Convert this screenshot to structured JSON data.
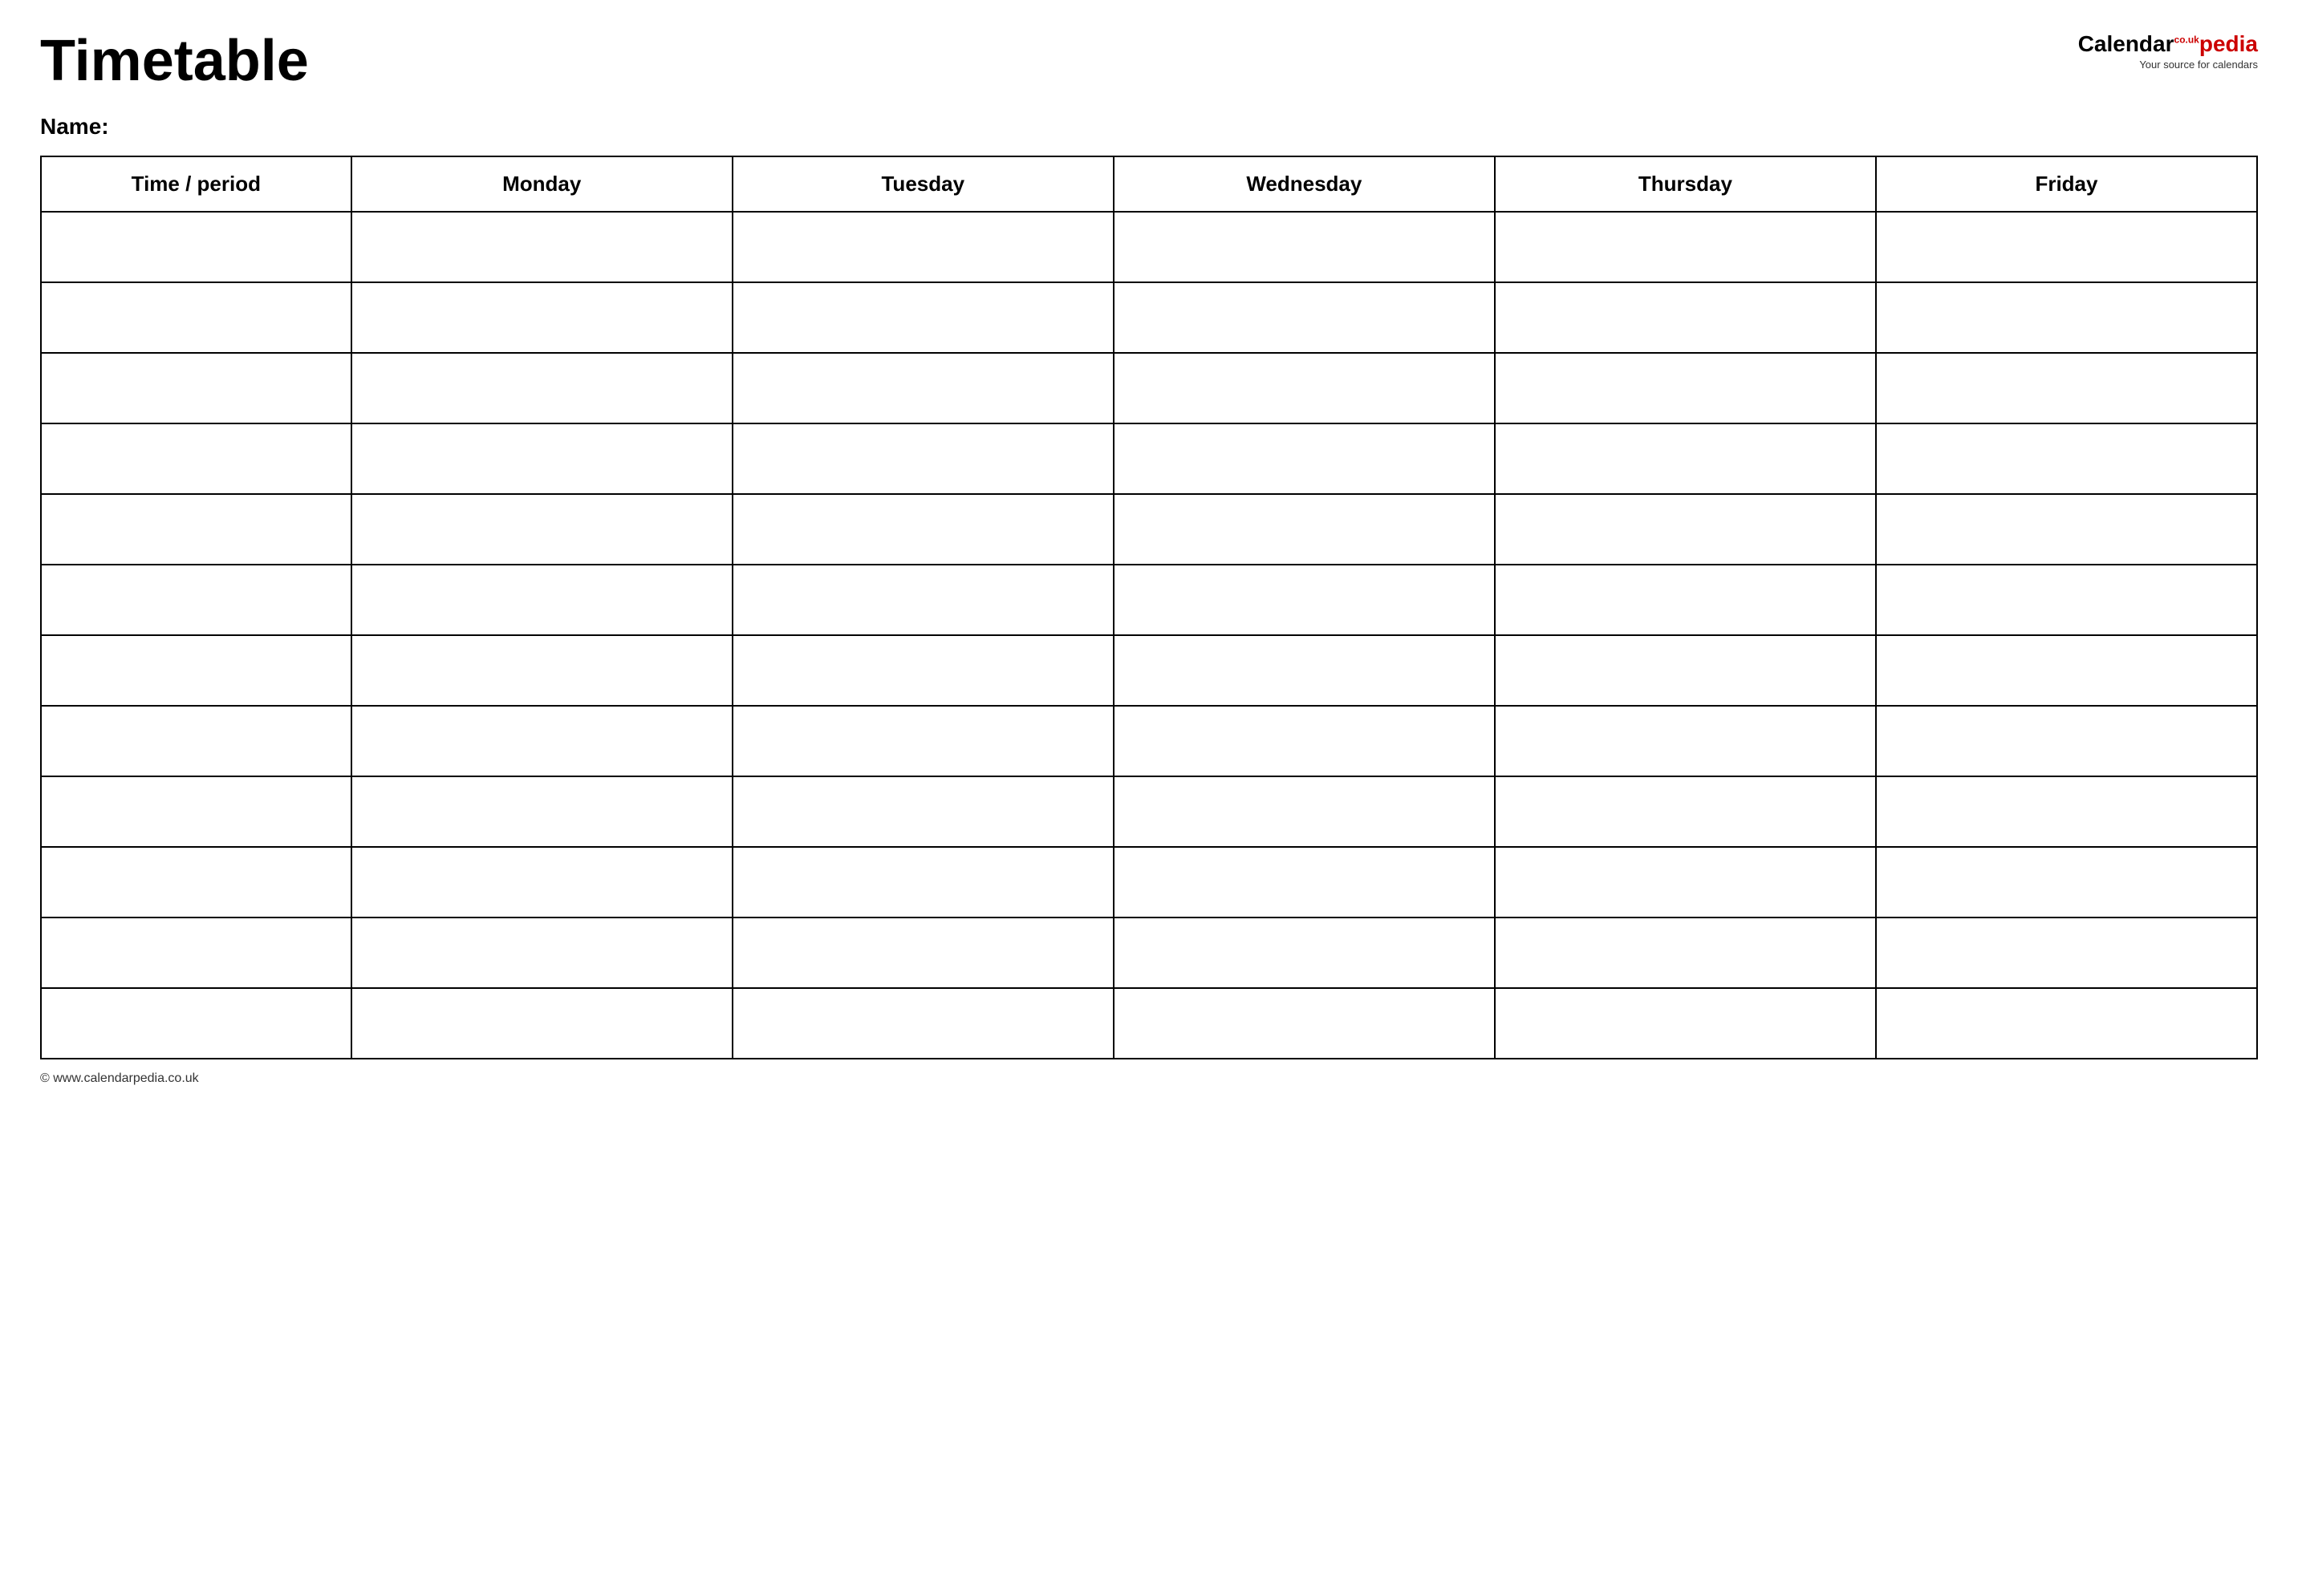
{
  "header": {
    "title": "Timetable",
    "logo": {
      "calendar_text": "Calendar",
      "pedia_text": "pedia",
      "co_uk": "co.uk",
      "tagline": "Your source for calendars"
    }
  },
  "name_label": "Name:",
  "table": {
    "columns": [
      "Time / period",
      "Monday",
      "Tuesday",
      "Wednesday",
      "Thursday",
      "Friday"
    ],
    "row_count": 12
  },
  "footer": {
    "url": "© www.calendarpedia.co.uk"
  }
}
